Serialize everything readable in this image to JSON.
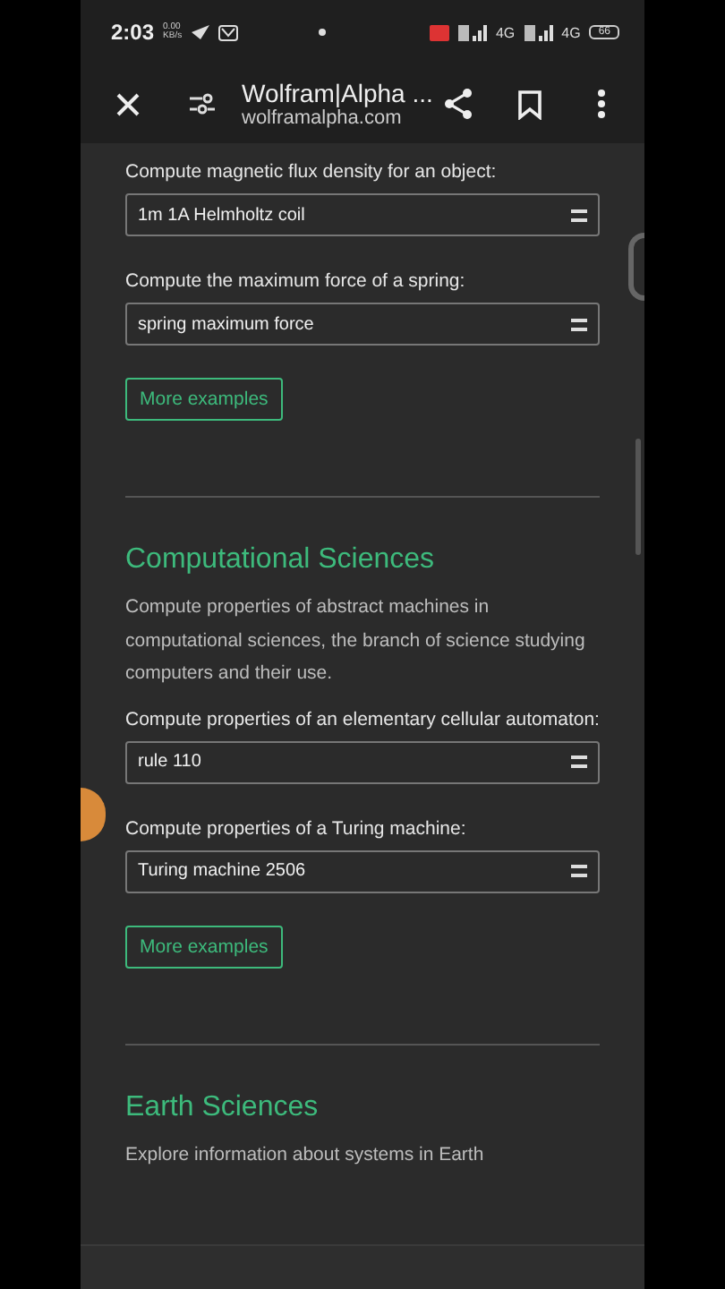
{
  "status_bar": {
    "time": "2:03",
    "net_speed": [
      "0.00",
      "KB/s"
    ],
    "network_labels": [
      "4G",
      "4G"
    ],
    "battery": "66"
  },
  "toolbar": {
    "title": "Wolfram|Alpha ...",
    "url": "wolframalpha.com"
  },
  "sections": [
    {
      "examples": [
        {
          "label": "Compute magnetic flux density for an object:",
          "query": "1m 1A Helmholtz coil"
        },
        {
          "label": "Compute the maximum force of a spring:",
          "query": "spring maximum force"
        }
      ],
      "more_button": "More examples"
    },
    {
      "title": "Computational Sciences",
      "description": "Compute properties of abstract machines in computational sciences, the branch of science studying computers and their use.",
      "examples": [
        {
          "label": "Compute properties of an elementary cellular automaton:",
          "query": "rule 110"
        },
        {
          "label": "Compute properties of a Turing machine:",
          "query": "Turing machine 2506"
        }
      ],
      "more_button": "More examples"
    },
    {
      "title": "Earth Sciences",
      "description": "Explore information about systems in Earth"
    }
  ]
}
